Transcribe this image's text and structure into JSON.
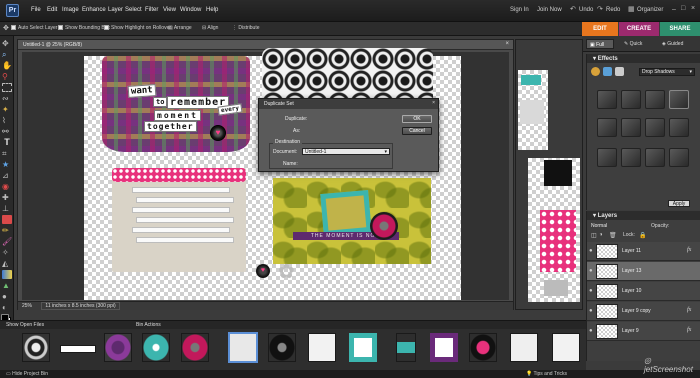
{
  "app": {
    "logo_text": "Pr"
  },
  "menu": {
    "items": [
      "File",
      "Edit",
      "Image",
      "Enhance",
      "Layer",
      "Select",
      "Filter",
      "View",
      "Window",
      "Help"
    ],
    "signin": "Sign In",
    "joinnow": "Join Now",
    "undo": "Undo",
    "redo": "Redo",
    "organizer": "Organizer"
  },
  "options": {
    "auto_select": "Auto Select Layer",
    "bounding_box": "Show Bounding Box",
    "highlight": "Show Highlight on Rollover",
    "arrange": "Arrange",
    "align": "Align",
    "distribute": "Distribute"
  },
  "modes": {
    "edit": "EDIT",
    "create": "CREATE",
    "share": "SHARE",
    "full": "Full",
    "quick": "Quick",
    "guided": "Guided"
  },
  "document": {
    "title": "Untitled-1 @ 25% (RGB/8)",
    "zoom": "25%",
    "size": "11 inches x 8.5 inches (300 ppi)"
  },
  "artwork": {
    "words": [
      "want",
      "to",
      "remember",
      "every",
      "moment",
      "together"
    ],
    "ribbon_text": "THE MOMENT IS NOW"
  },
  "dialog": {
    "title": "Duplicate Set",
    "duplicate_label": "Duplicate:",
    "as_label": "As:",
    "destination_label": "Destination",
    "document_label": "Document:",
    "document_value": "Untitled-1",
    "name_label": "Name:",
    "ok": "OK",
    "cancel": "Cancel"
  },
  "effects": {
    "title": "Effects",
    "dropdown_value": "Drop Shadows",
    "apply": "Apply"
  },
  "layers": {
    "title": "Layers",
    "blend_mode": "Normal",
    "opacity_label": "Opacity:",
    "lock_label": "Lock:",
    "rows": [
      {
        "name": "Layer 11",
        "fx": "fx"
      },
      {
        "name": "Layer 13",
        "fx": ""
      },
      {
        "name": "Layer 10",
        "fx": ""
      },
      {
        "name": "Layer 9 copy",
        "fx": "fx"
      },
      {
        "name": "Layer 9",
        "fx": "fx"
      }
    ]
  },
  "bin": {
    "show_open_files": "Show Open Files",
    "bin_actions": "Bin Actions",
    "hide_bin": "Hide Project Bin",
    "tips": "Tips and Tricks"
  },
  "watermark": "jetScreenshot",
  "colors": {
    "edit_tab": "#e8761e",
    "create_tab": "#9c2a6e",
    "share_tab": "#2e8f6e",
    "dot_pink": "#e8317c",
    "teal": "#3cb5ae"
  }
}
